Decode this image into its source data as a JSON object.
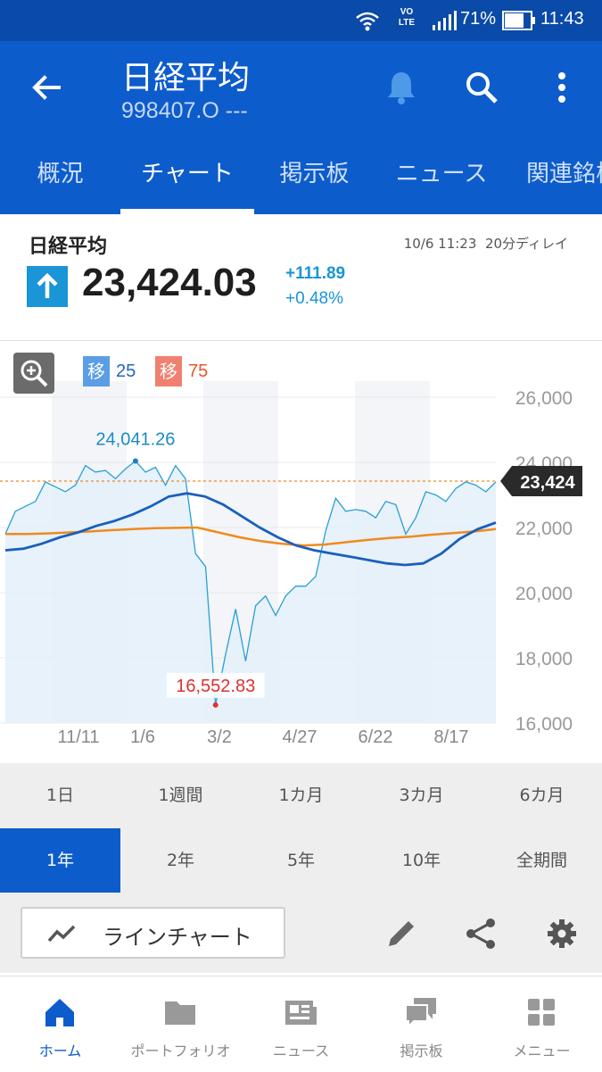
{
  "status_bar": {
    "battery": "71%",
    "time": "11:43",
    "volte": "VO\nLTE"
  },
  "app_bar": {
    "title": "日経平均",
    "subtitle": "998407.O ---"
  },
  "tabs": [
    {
      "label": "概況"
    },
    {
      "label": "チャート"
    },
    {
      "label": "掲示板"
    },
    {
      "label": "ニュース"
    },
    {
      "label": "関連銘柄"
    }
  ],
  "quote": {
    "name": "日経平均",
    "timestamp": "10/6 11:23",
    "delay": "20分ディレイ",
    "price": "23,424.03",
    "change": "+111.89",
    "change_pct": "+0.48%"
  },
  "chart_data": {
    "type": "line",
    "current_price_label": "23,424",
    "high_label": "24,041.26",
    "low_label": "16,552.83",
    "ylim": [
      16000,
      26000
    ],
    "yticks": [
      "26,000",
      "24,000",
      "22,000",
      "20,000",
      "18,000",
      "16,000"
    ],
    "ytick_values": [
      26000,
      24000,
      22000,
      20000,
      18000,
      16000
    ],
    "xticks": [
      "11/11",
      "1/6",
      "3/2",
      "4/27",
      "6/22",
      "8/17"
    ],
    "moving_averages": [
      {
        "label": "移",
        "period": "25",
        "color": "#2266c4",
        "box_color": "#5b9ee6"
      },
      {
        "label": "移",
        "period": "75",
        "color": "#e8562f",
        "box_color": "#f08070"
      }
    ],
    "series": [
      {
        "values": [
          21800,
          22500,
          22650,
          22800,
          23400,
          23250,
          23100,
          23300,
          23900,
          23700,
          23750,
          23500,
          23800,
          24041,
          23700,
          23850,
          23300,
          23900,
          23500,
          21200,
          20800,
          16553,
          18100,
          19500,
          17900,
          19600,
          19900,
          19300,
          19900,
          20200,
          20200,
          20500,
          21900,
          22900,
          22500,
          22550,
          22500,
          22300,
          22800,
          22700,
          21800,
          22300,
          23100,
          23000,
          22800,
          23200,
          23400,
          23300,
          23100,
          23400
        ]
      },
      {
        "values": [
          21300,
          21350,
          21500,
          21700,
          21850,
          22050,
          22200,
          22400,
          22650,
          22950,
          23050,
          22950,
          22700,
          22350,
          22000,
          21700,
          21450,
          21300,
          21200,
          21100,
          21000,
          20900,
          20850,
          20900,
          21200,
          21650,
          21950,
          22150
        ]
      },
      {
        "values": [
          21800,
          21800,
          21820,
          21850,
          21880,
          21920,
          21950,
          21980,
          21990,
          22000,
          21850,
          21700,
          21580,
          21500,
          21450,
          21480,
          21550,
          21620,
          21680,
          21720,
          21780,
          21830,
          21880,
          21950
        ]
      }
    ]
  },
  "periods": [
    {
      "label": "1日"
    },
    {
      "label": "1週間"
    },
    {
      "label": "1カ月"
    },
    {
      "label": "3カ月"
    },
    {
      "label": "6カ月"
    },
    {
      "label": "1年"
    },
    {
      "label": "2年"
    },
    {
      "label": "5年"
    },
    {
      "label": "10年"
    },
    {
      "label": "全期間"
    }
  ],
  "toolbar": {
    "chart_type_label": "ラインチャート"
  },
  "bottom_nav": [
    {
      "label": "ホーム"
    },
    {
      "label": "ポートフォリオ"
    },
    {
      "label": "ニュース"
    },
    {
      "label": "掲示板"
    },
    {
      "label": "メニュー"
    }
  ],
  "colors": {
    "primary": "#0d5ccc",
    "up": "#1a95d6",
    "ma25": "#1a5fbd",
    "ma75": "#f08a1c",
    "low_label": "#e03030"
  }
}
